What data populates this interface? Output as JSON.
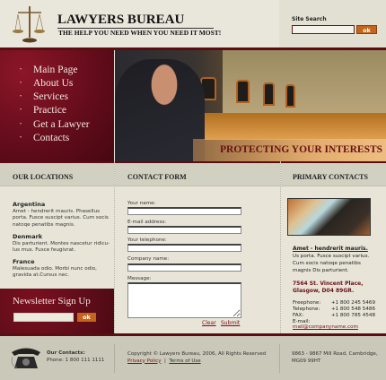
{
  "header": {
    "title": "LAWYERS BUREAU",
    "tagline": "THE HELP YOU NEED WHEN YOU NEED IT MOST!"
  },
  "search": {
    "label": "Site Search",
    "value": "",
    "button": "ok"
  },
  "nav": {
    "items": [
      {
        "label": "Main Page"
      },
      {
        "label": "About Us"
      },
      {
        "label": "Services"
      },
      {
        "label": "Practice"
      },
      {
        "label": "Get a Lawyer"
      },
      {
        "label": "Contacts"
      }
    ]
  },
  "hero": {
    "banner": "PROTECTING YOUR INTERESTS"
  },
  "locations": {
    "heading": "OUR LOCATIONS",
    "items": [
      {
        "name": "Argentina",
        "text": "Amet - hendrerit mauris. Phasellus porta. Fusce suscipt varius. Cum socis natoqe penatibs magnis."
      },
      {
        "name": "Denmark",
        "text": "Dis parturient.  Montes nascetur ridicu-lus mus. Fusce feugivrat."
      },
      {
        "name": "France",
        "text": "Malesuada odio. Morbi nunc odio, gravida at.Cursus nec."
      }
    ]
  },
  "newsletter": {
    "title": "Newsletter Sign Up",
    "value": "",
    "button": "ok"
  },
  "contact_form": {
    "heading": "CONTACT FORM",
    "fields": [
      {
        "label": "Your name:",
        "value": ""
      },
      {
        "label": "E-mail address:",
        "value": ""
      },
      {
        "label": "Your telephone:",
        "value": ""
      },
      {
        "label": "Company name:",
        "value": ""
      },
      {
        "label": "Message:",
        "value": ""
      }
    ],
    "clear": "Clear",
    "submit": "Submit"
  },
  "primary": {
    "heading": "PRIMARY CONTACTS",
    "title": "Amet - hendrerit mauris.",
    "text": "Us porta. Fusce suscipt varius. Cum socis natoqe penatibs magnis Dis parturient.",
    "address1": "7564 St. Vincent Place,",
    "address2": "Glasgow, D04 89GR.",
    "rows": [
      {
        "label": "Freephone:",
        "value": "+1 800 245 5469"
      },
      {
        "label": "Telephone:",
        "value": "+1 800 548 5486"
      },
      {
        "label": "FAX:",
        "value": "+1 800 785 4548"
      }
    ],
    "email_label": "E-mail:",
    "email": "mail@companyname.com"
  },
  "footer": {
    "contacts_title": "Our Contacts:",
    "phone": "Phone: 1 800 111 1111",
    "copyright": "Copyright © Lawyers Bureau, 2006, All Rights Reserved",
    "privacy": "Privacy Policy",
    "sep": "|",
    "terms": "Terms of Use",
    "address1": "9863 - 9867 Mill Road, Cambridge,",
    "address2": "MG09 99HT"
  }
}
